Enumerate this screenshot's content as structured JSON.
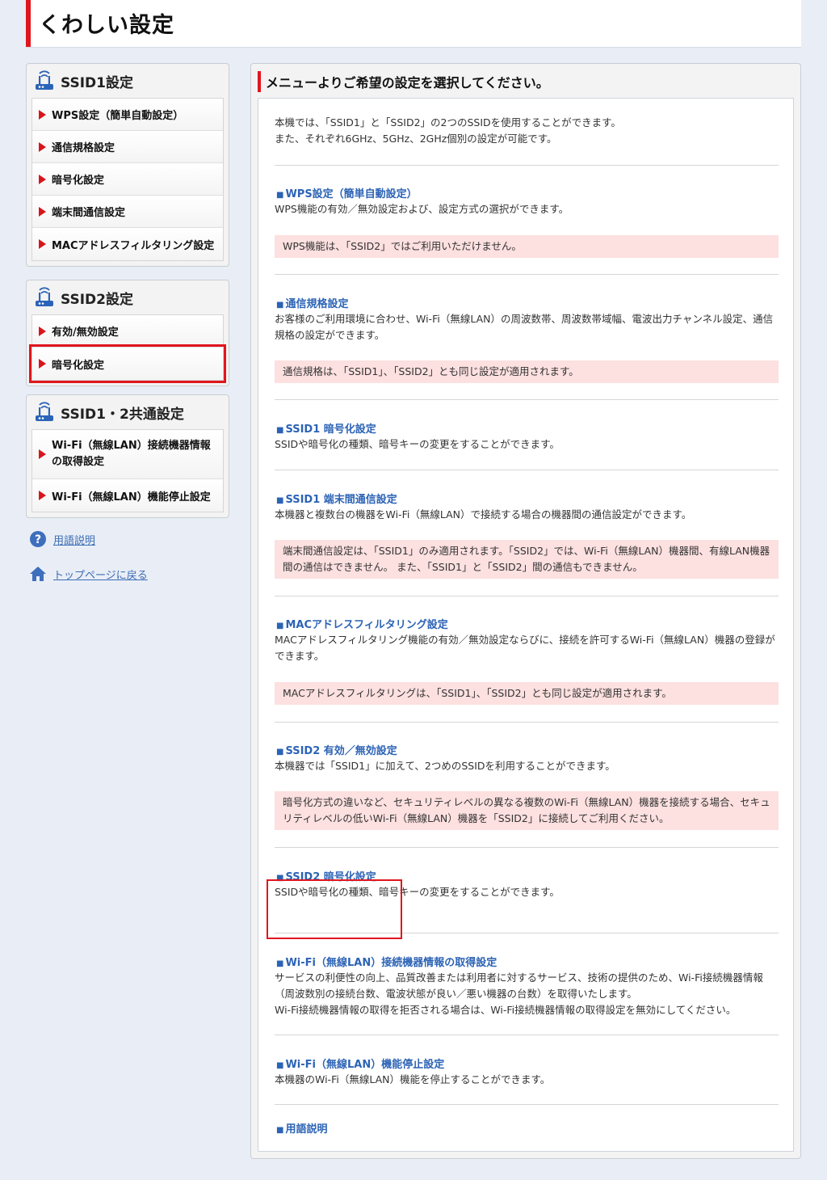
{
  "header": {
    "title": "くわしい設定"
  },
  "sidebar": {
    "ssid1": {
      "title": "SSID1設定",
      "items": [
        {
          "label": "WPS設定（簡単自動設定）"
        },
        {
          "label": "通信規格設定"
        },
        {
          "label": "暗号化設定"
        },
        {
          "label": "端末間通信設定"
        },
        {
          "label": "MACアドレスフィルタリング設定"
        }
      ]
    },
    "ssid2": {
      "title": "SSID2設定",
      "items": [
        {
          "label": "有効/無効設定"
        },
        {
          "label": "暗号化設定"
        }
      ]
    },
    "common": {
      "title": "SSID1・2共通設定",
      "items": [
        {
          "label": "Wi-Fi（無線LAN）接続機器情報の取得設定"
        },
        {
          "label": "Wi-Fi（無線LAN）機能停止設定"
        }
      ]
    },
    "links": {
      "glossary": "用語説明",
      "top": "トップページに戻る"
    }
  },
  "main": {
    "title": "メニューよりご希望の設定を選択してください。",
    "intro": [
      "本機では、「SSID1」と「SSID2」の2つのSSIDを使用することができます。",
      "また、それぞれ6GHz、5GHz、2GHz個別の設定が可能です。"
    ],
    "sections": [
      {
        "title": "WPS設定（簡単自動設定）",
        "desc": "WPS機能の有効／無効設定および、設定方式の選択ができます。",
        "note": "WPS機能は、「SSID2」ではご利用いただけません。"
      },
      {
        "title": "通信規格設定",
        "desc": "お客様のご利用環境に合わせ、Wi-Fi（無線LAN）の周波数帯、周波数帯域幅、電波出力チャンネル設定、通信規格の設定ができます。",
        "note": "通信規格は、「SSID1」、「SSID2」とも同じ設定が適用されます。"
      },
      {
        "title": "SSID1 暗号化設定",
        "desc": "SSIDや暗号化の種類、暗号キーの変更をすることができます。"
      },
      {
        "title": "SSID1 端末間通信設定",
        "desc": "本機器と複数台の機器をWi-Fi（無線LAN）で接続する場合の機器間の通信設定ができます。",
        "note": "端末間通信設定は、「SSID1」のみ適用されます。「SSID2」では、Wi-Fi（無線LAN）機器間、有線LAN機器間の通信はできません。 また、「SSID1」と「SSID2」間の通信もできません。"
      },
      {
        "title": "MACアドレスフィルタリング設定",
        "desc": "MACアドレスフィルタリング機能の有効／無効設定ならびに、接続を許可するWi-Fi（無線LAN）機器の登録ができます。",
        "note": "MACアドレスフィルタリングは、「SSID1」、「SSID2」とも同じ設定が適用されます。"
      },
      {
        "title": "SSID2 有効／無効設定",
        "desc": "本機器では「SSID1」に加えて、2つめのSSIDを利用することができます。",
        "note": "暗号化方式の違いなど、セキュリティレベルの異なる複数のWi-Fi（無線LAN）機器を接続する場合、セキュリティレベルの低いWi-Fi（無線LAN）機器を「SSID2」に接続してご利用ください。"
      },
      {
        "title": "SSID2 暗号化設定",
        "desc": "SSIDや暗号化の種類、暗号キーの変更をすることができます。"
      },
      {
        "title": "Wi-Fi（無線LAN）接続機器情報の取得設定",
        "desc": "サービスの利便性の向上、品質改善または利用者に対するサービス、技術の提供のため、Wi-Fi接続機器情報（周波数別の接続台数、電波状態が良い／悪い機器の台数）を取得いたします。",
        "desc2": "Wi-Fi接続機器情報の取得を拒否される場合は、Wi-Fi接続機器情報の取得設定を無効にしてください。"
      },
      {
        "title": "Wi-Fi（無線LAN）機能停止設定",
        "desc": "本機器のWi-Fi（無線LAN）機能を停止することができます。"
      },
      {
        "title": "用語説明"
      }
    ]
  },
  "colors": {
    "accent": "#e0161e",
    "link": "#2c63b5",
    "note_bg": "#fde0e0",
    "page_bg": "#e9eef6"
  }
}
